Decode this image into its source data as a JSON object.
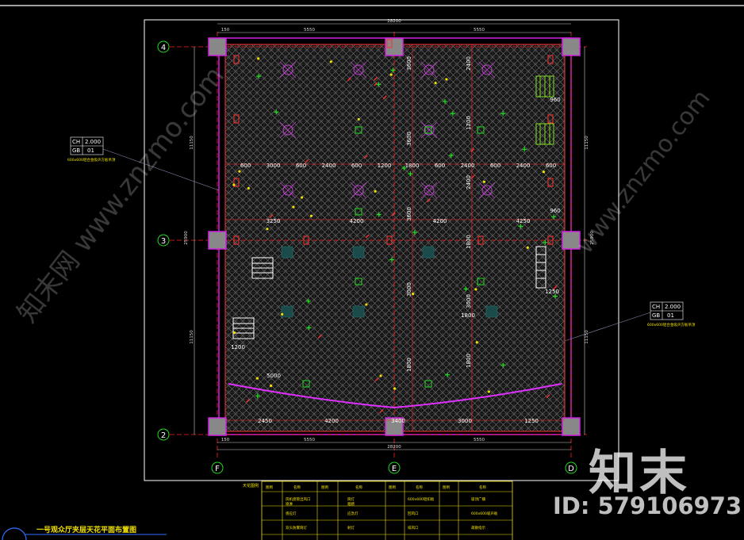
{
  "drawing_title": "一号观众厅夹层天花平面布置图",
  "overall_dim": "28200",
  "half_dims": [
    "5550",
    "5550"
  ],
  "edge_dim": "150",
  "axes": {
    "rows": [
      "4",
      "3",
      "2"
    ],
    "cols": [
      "F",
      "E",
      "D"
    ]
  },
  "side_dims": [
    "11150",
    "11150"
  ],
  "side_total": "25900",
  "row_dims_a": [
    "600",
    "3000",
    "600",
    "2400",
    "600",
    "1200",
    "1800",
    "600",
    "2400",
    "600",
    "2400",
    "600"
  ],
  "row_dims_b": [
    "3250",
    "4200",
    "4200",
    "4250"
  ],
  "bottom_dims": [
    "2450",
    "4200",
    "3400",
    "3000",
    "1250"
  ],
  "vert_dims": [
    "3600",
    "3600",
    "3600",
    "3000",
    "1800",
    "2400",
    "1200",
    "2400",
    "1800",
    "3000",
    "1800"
  ],
  "small_dims": [
    "960",
    "960",
    "1200",
    "1250",
    "1800",
    "5000"
  ],
  "callout_left": {
    "ch": "CH",
    "ch_val": "2.000",
    "gs": "GB",
    "gs_val": "01",
    "note": "600x600铝合金吸声方板吊顶"
  },
  "callout_right": {
    "ch": "CH",
    "ch_val": "2.000",
    "gs": "GB",
    "gs_val": "01",
    "note": "600x600铝合金吸声方板吊顶"
  },
  "legend": {
    "caption": "天花图例",
    "headers": [
      "图例",
      "名称",
      "图例",
      "名称",
      "图例",
      "名称",
      "图例",
      "名称"
    ],
    "rows": [
      [
        "风机盘管出风口",
        "筒灯",
        "600x600铝扣板",
        "吸顶广播",
        "喷淋",
        "烟感"
      ],
      [
        "感应灯",
        "应急灯",
        "回风口",
        "600x600吸声板"
      ],
      [
        "双头防雾筒灯",
        "射灯",
        "排风口",
        "疏散指示"
      ],
      [
        "消防应急照明",
        "出入口指示灯",
        "检修口"
      ]
    ]
  },
  "watermark": {
    "logo": "知末",
    "id": "ID: 579106973",
    "site": "www.znzmo.com",
    "cn": "知末网"
  },
  "colors": {
    "grid": "#9a9a9a",
    "border": "#ffffff",
    "red": "#ff2020",
    "magenta": "#d020e0",
    "green": "#20e020",
    "yellow": "#f0e000",
    "cyan": "#20c0c0"
  }
}
